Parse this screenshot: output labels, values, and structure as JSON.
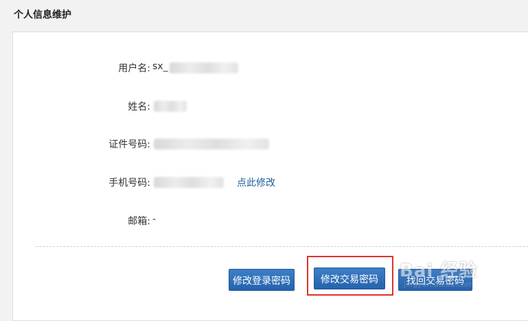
{
  "page": {
    "title": "个人信息维护"
  },
  "profile": {
    "username_label": "用户名:",
    "username_value": "sx_",
    "name_label": "姓名:",
    "id_label": "证件号码:",
    "phone_label": "手机号码:",
    "phone_edit_link": "点此修改",
    "email_label": "邮箱:",
    "email_value": "-"
  },
  "actions": {
    "change_login_password": "修改登录密码",
    "change_trade_password": "修改交易密码",
    "third_button": "找回交易密码"
  },
  "watermark": {
    "logo": "Bai 经验",
    "url": "jingyan.baidu.com"
  },
  "colors": {
    "button_blue": "#2d6fb8",
    "link_blue": "#1a5d9a",
    "highlight_red": "#e0302a"
  }
}
